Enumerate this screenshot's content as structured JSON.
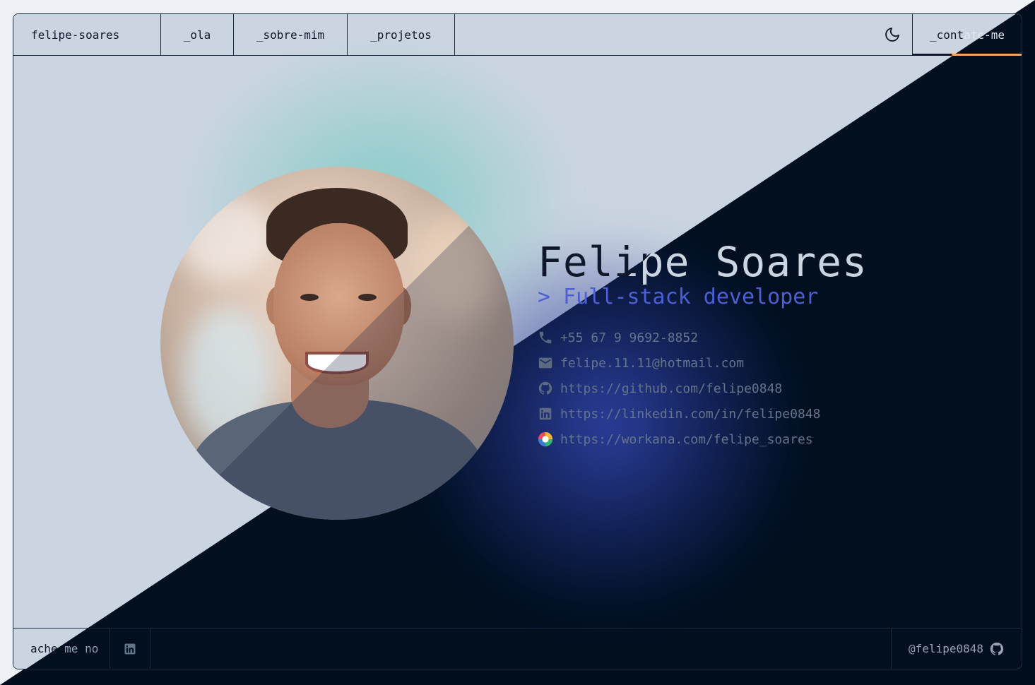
{
  "header": {
    "brand": "felipe-soares",
    "nav": [
      {
        "label": "_ola"
      },
      {
        "label": "_sobre-mim"
      },
      {
        "label": "_projetos"
      }
    ],
    "theme_icon": "moon-icon",
    "contact_label": "_contate-me"
  },
  "profile": {
    "name": "Felipe Soares",
    "role": "> Full-stack developer",
    "photo_alt": "Felipe Soares"
  },
  "contacts": [
    {
      "icon": "phone-icon",
      "text": "+55 67 9 9692-8852"
    },
    {
      "icon": "mail-icon",
      "text": "felipe.11.11@hotmail.com"
    },
    {
      "icon": "github-icon",
      "text": "https://github.com/felipe0848"
    },
    {
      "icon": "linkedin-icon",
      "text": "https://linkedin.com/in/felipe0848"
    },
    {
      "icon": "workana-icon",
      "text": "https://workana.com/felipe_soares"
    }
  ],
  "footer": {
    "find_me": "ache-me no",
    "github_handle": "@felipe0848"
  },
  "colors": {
    "light_bg": "#cbd5e1",
    "dark_bg": "#010f1f",
    "accent": "#f4a261",
    "role": "#4c5fd5"
  }
}
